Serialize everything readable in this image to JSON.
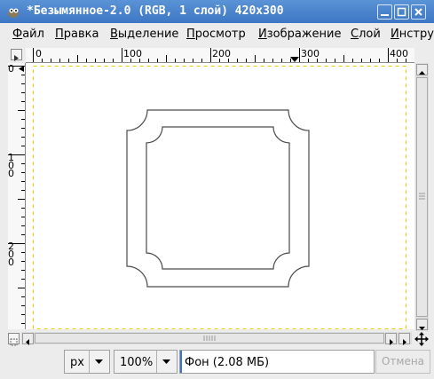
{
  "window": {
    "title": "*Безымянное-2.0 (RGB, 1 слой) 420x300",
    "app_icon": "gimp-wilber-icon",
    "controls": [
      "minimize-icon",
      "maximize-icon",
      "close-icon"
    ]
  },
  "menu": {
    "items": [
      "Файл",
      "Правка",
      "Выделение",
      "Просмотр",
      "Изображение",
      "Слой",
      "Инстру"
    ],
    "mnemonics": [
      "Ф",
      "П",
      "В",
      "П",
      "И",
      "С",
      "И"
    ]
  },
  "rulers": {
    "horizontal_labels": [
      "0",
      "100",
      "200",
      "300",
      "400"
    ],
    "vertical_labels": [
      "0",
      "100",
      "200"
    ]
  },
  "statusbar": {
    "unit": "px",
    "zoom": "100%",
    "message": "Фон (2.08 МБ)",
    "cancel_label": "Отмена"
  },
  "colors": {
    "titlebar": "#4a84cc",
    "selection_border": "#f0e000",
    "frame_stroke": "#4a4a4a"
  }
}
